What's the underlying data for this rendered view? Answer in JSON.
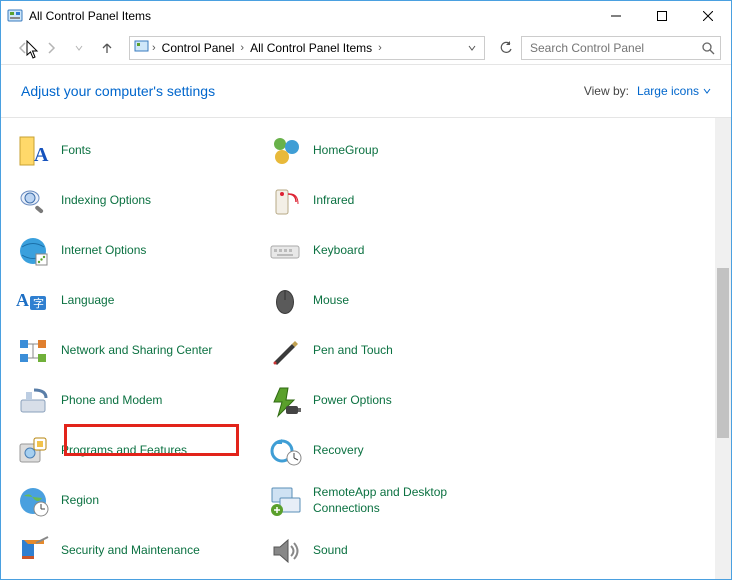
{
  "window": {
    "title": "All Control Panel Items"
  },
  "breadcrumb": {
    "root": "Control Panel",
    "current": "All Control Panel Items"
  },
  "search": {
    "placeholder": "Search Control Panel"
  },
  "header": {
    "heading": "Adjust your computer's settings",
    "viewby_label": "View by:",
    "viewby_value": "Large icons"
  },
  "items": {
    "left": [
      {
        "label": "Fonts",
        "icon": "fonts"
      },
      {
        "label": "Indexing Options",
        "icon": "indexing"
      },
      {
        "label": "Internet Options",
        "icon": "internet"
      },
      {
        "label": "Language",
        "icon": "language"
      },
      {
        "label": "Network and Sharing Center",
        "icon": "network"
      },
      {
        "label": "Phone and Modem",
        "icon": "phone"
      },
      {
        "label": "Programs and Features",
        "icon": "programs",
        "highlight": true
      },
      {
        "label": "Region",
        "icon": "region"
      },
      {
        "label": "Security and Maintenance",
        "icon": "security"
      }
    ],
    "right": [
      {
        "label": "HomeGroup",
        "icon": "homegroup"
      },
      {
        "label": "Infrared",
        "icon": "infrared"
      },
      {
        "label": "Keyboard",
        "icon": "keyboard"
      },
      {
        "label": "Mouse",
        "icon": "mouse"
      },
      {
        "label": "Pen and Touch",
        "icon": "pen"
      },
      {
        "label": "Power Options",
        "icon": "power"
      },
      {
        "label": "Recovery",
        "icon": "recovery"
      },
      {
        "label": "RemoteApp and Desktop Connections",
        "icon": "remoteapp"
      },
      {
        "label": "Sound",
        "icon": "sound"
      }
    ]
  }
}
